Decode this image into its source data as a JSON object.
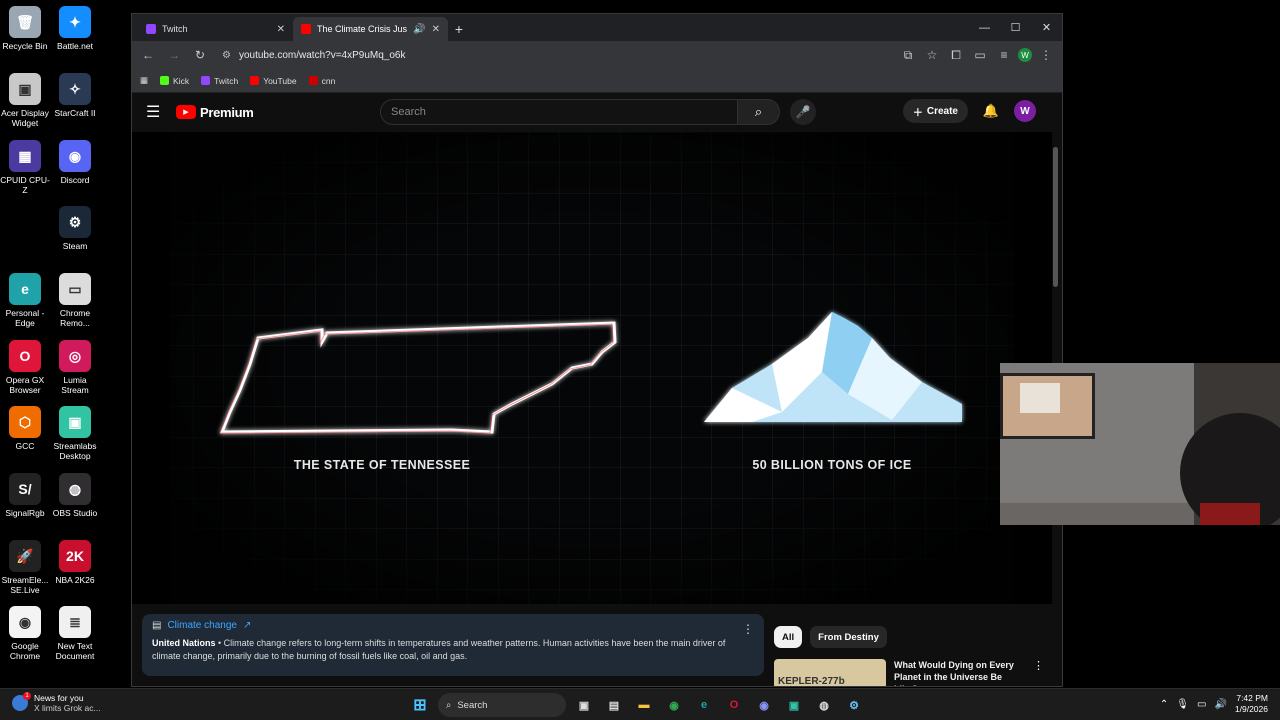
{
  "desktop": {
    "icons": [
      {
        "label": "Recycle Bin",
        "color": "#9aa6b2",
        "glyph": "🗑"
      },
      {
        "label": "Battle.net",
        "color": "#148eff",
        "glyph": "✦"
      },
      {
        "label": "Acer Display\nWidget",
        "color": "#c8c8c8",
        "glyph": "▣"
      },
      {
        "label": "StarCraft II",
        "color": "#2a3a55",
        "glyph": "✧"
      },
      {
        "label": "CPUID CPU-Z",
        "color": "#4b3aa0",
        "glyph": "▦"
      },
      {
        "label": "Discord",
        "color": "#5865f2",
        "glyph": "◉"
      },
      {
        "label": "Steam",
        "color": "#1b2838",
        "glyph": "⚙"
      },
      {
        "label": "Personal -\nEdge",
        "color": "#1fa3a8",
        "glyph": "e"
      },
      {
        "label": "Chrome\nRemo...",
        "color": "#dcdcdc",
        "glyph": "▭"
      },
      {
        "label": "Opera GX\nBrowser",
        "color": "#e0153a",
        "glyph": "O"
      },
      {
        "label": "Lumia\nStream",
        "color": "#d11a5c",
        "glyph": "◎"
      },
      {
        "label": "GCC",
        "color": "#ef6c00",
        "glyph": "⬡"
      },
      {
        "label": "Streamlabs\nDesktop",
        "color": "#31c3a2",
        "glyph": "▣"
      },
      {
        "label": "SignalRgb",
        "color": "#222",
        "glyph": "S/"
      },
      {
        "label": "OBS Studio",
        "color": "#302e31",
        "glyph": "◍"
      },
      {
        "label": "StreamEle...\nSE.Live",
        "color": "#222",
        "glyph": "🚀"
      },
      {
        "label": "NBA 2K26",
        "color": "#c8102e",
        "glyph": "2K"
      },
      {
        "label": "Google\nChrome",
        "color": "#f4f4f4",
        "glyph": "◉"
      },
      {
        "label": "New Text\nDocument",
        "color": "#f0f0f0",
        "glyph": "≣"
      }
    ]
  },
  "browser": {
    "tabs": [
      {
        "title": "Twitch",
        "favicon_color": "#9146ff",
        "active": false
      },
      {
        "title": "The Climate Crisis Just Hit a",
        "favicon_color": "#ff0000",
        "active": true
      }
    ],
    "new_tab": "+",
    "url": "youtube.com/watch?v=4xP9uMq_o6k",
    "profile_initial": "W",
    "bookmarks": [
      {
        "label": "Kick",
        "color": "#53fc18"
      },
      {
        "label": "Twitch",
        "color": "#9146ff"
      },
      {
        "label": "YouTube",
        "color": "#ff0000"
      },
      {
        "label": "cnn",
        "color": "#cc0000"
      }
    ]
  },
  "youtube": {
    "logo_text": "Premium",
    "search_placeholder": "Search",
    "create_label": "Create",
    "avatar_initial": "W",
    "video_captions": {
      "left": "THE STATE OF TENNESSEE",
      "right": "50 BILLION TONS OF ICE"
    },
    "info_panel": {
      "title": "Climate change",
      "source": "United Nations",
      "text": " • Climate change refers to long-term shifts in temperatures and weather patterns. Human activities have been the main driver of climate change, primarily due to the burning of fossil fuels like coal, oil and gas."
    },
    "chips": [
      "All",
      "From Destiny"
    ],
    "recommendation": {
      "thumb_text": "KEPLER-277b",
      "title": "What Would Dying on Every Planet in the Universe Be Like?"
    }
  },
  "taskbar": {
    "news_title": "News for you",
    "news_sub": "X limits Grok ac...",
    "news_badge": "1",
    "search_label": "Search",
    "time": "7:42 PM",
    "date": "1/9/2026"
  }
}
